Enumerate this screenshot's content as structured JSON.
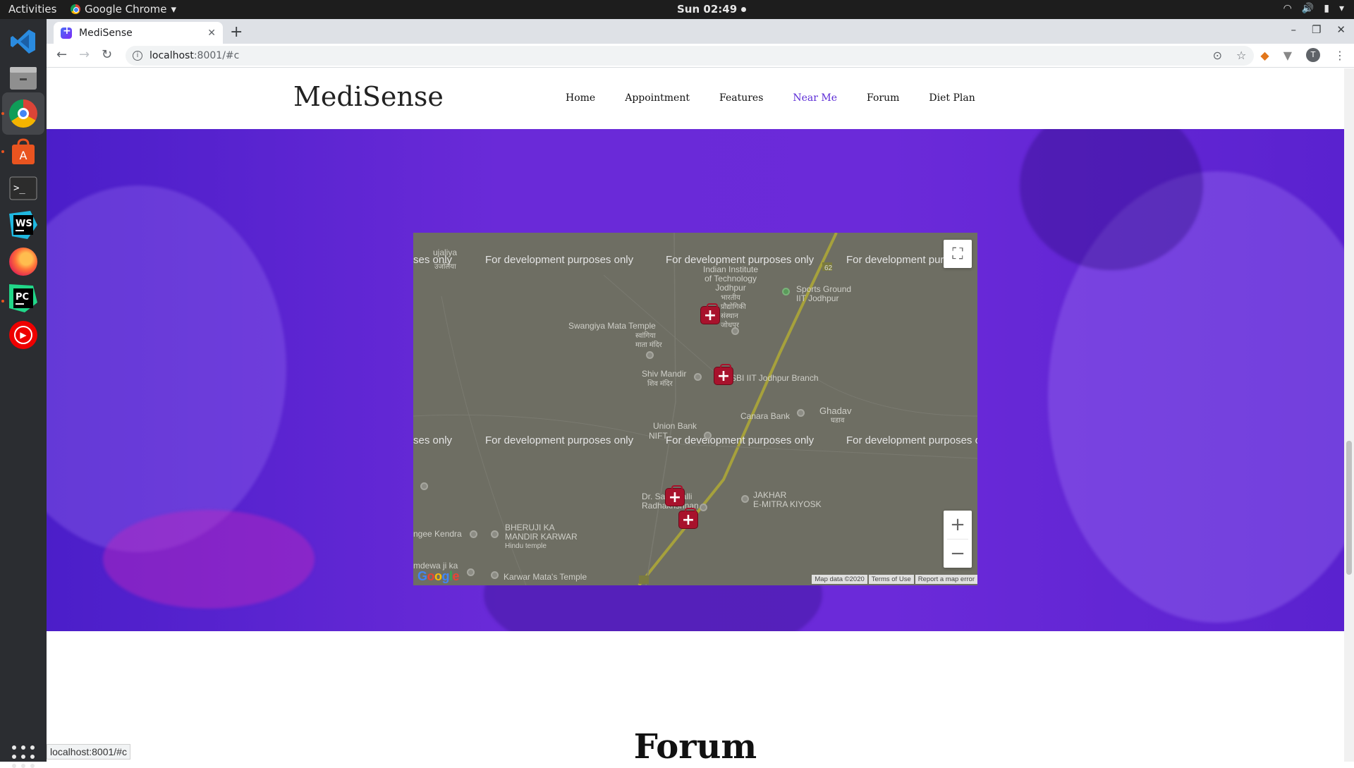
{
  "os": {
    "activities": "Activities",
    "app_menu": "Google Chrome",
    "clock": "Sun 02:49",
    "dock_icons": [
      "vscode-icon",
      "files-icon",
      "chrome-icon",
      "software-center-icon",
      "terminal-icon",
      "webstorm-icon",
      "firefox-icon",
      "pycharm-icon",
      "youtube-music-icon",
      "apps-grid-icon"
    ]
  },
  "browser": {
    "tab_title": "MediSense",
    "url_host": "localhost",
    "url_path": ":8001/#c",
    "avatar_letter": "T",
    "status_url": "localhost:8001/#c"
  },
  "site": {
    "brand": "MediSense",
    "nav": [
      "Home",
      "Appointment",
      "Features",
      "Near Me",
      "Forum",
      "Diet Plan"
    ],
    "active_nav": "Near Me",
    "accent_color": "#5b2bd6",
    "hero_color": "#6a2ad8",
    "forum_heading": "Forum"
  },
  "map": {
    "dev_watermark": "For development purposes only",
    "dev_fragment_left": "ses only",
    "dev_fragment_right": "For development pur",
    "dev_fragment_right2": "For development purposes o",
    "pois": {
      "iit": "Indian Institute\nof Technology\nJodhpur",
      "iit_hindi": "भारतीय\nप्रौद्योगिकी\nसंस्थान\nजोधपुर",
      "sports": "Sports Ground\nIIT Jodhpur",
      "swangiya": "Swangiya Mata Temple",
      "swangiya_hindi": "स्वांगिया\nमाता मंदिर",
      "shiv": "Shiv Mandir",
      "shiv_hindi": "शिव मंदिर",
      "sbi": "SBI IIT Jodhpur Branch",
      "canara": "Canara Bank",
      "ghadav": "Ghadav",
      "ghadav_hindi": "घडाव",
      "union": "Union Bank",
      "nifft": "NIFT",
      "drs": "Dr. Sarvepalli\nRadhakrishnan",
      "jakhar": "JAKHAR\nE-MITRA KIYOSK",
      "bheruji": "BHERUJI KA\nMANDIR KARWAR",
      "bheruji_sub": "Hindu temple",
      "karwar": "Karwar Mata's Temple",
      "anganwadi": "ngee Kendra",
      "ujaliya": "ujaliya",
      "ujaliya_hindi": "उजलिया",
      "mdewa": "mdewa ji ka"
    },
    "route_shield": "62",
    "footer": [
      "Map data ©2020",
      "Terms of Use",
      "Report a map error"
    ],
    "google_logo": "Google"
  }
}
